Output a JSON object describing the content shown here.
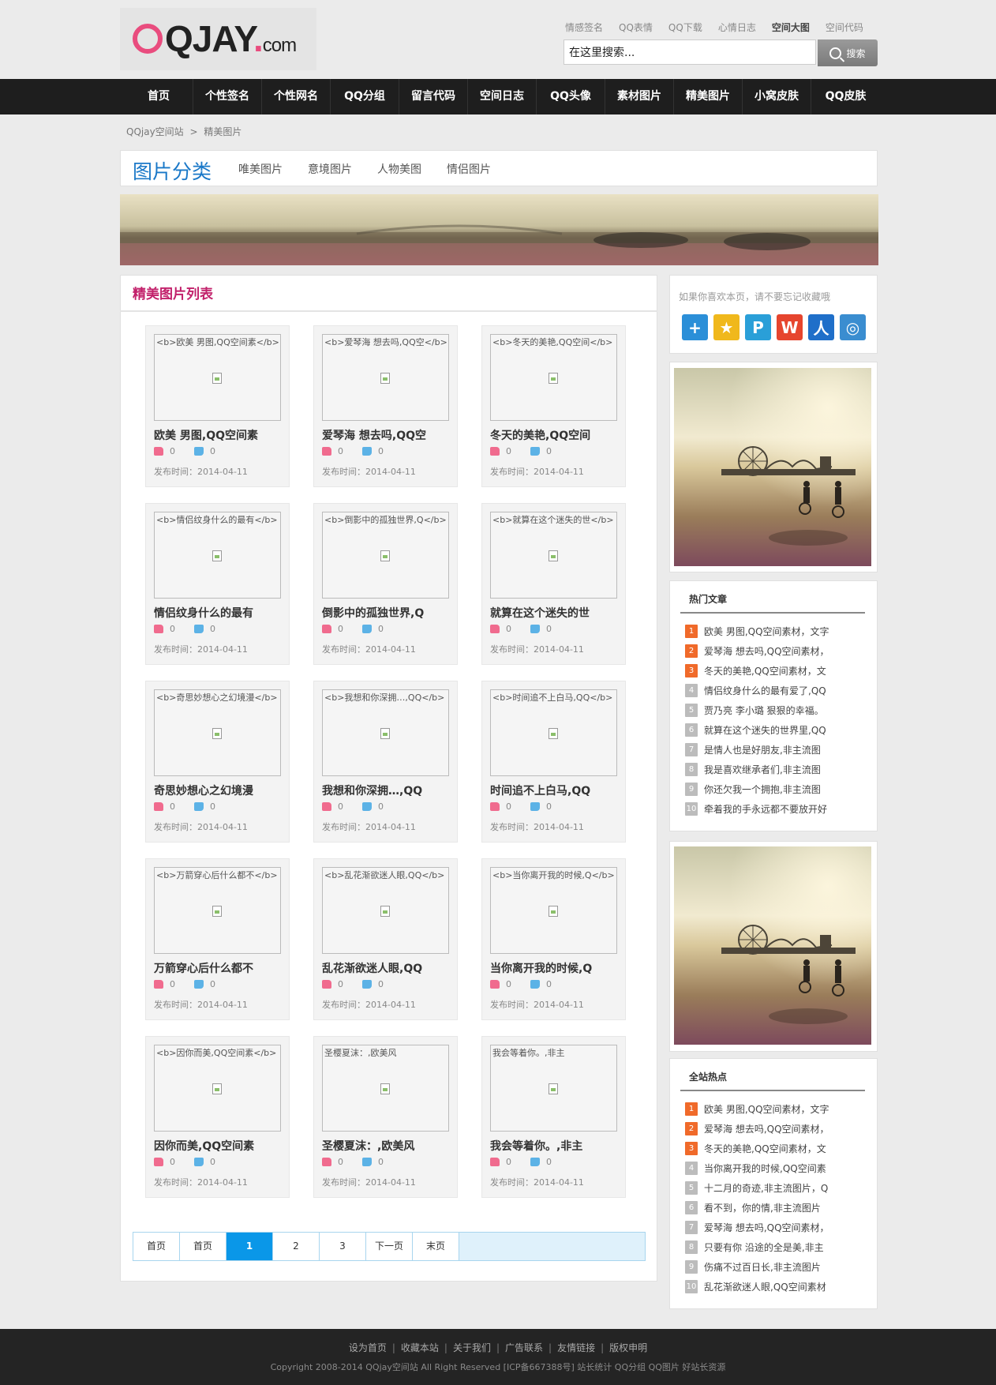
{
  "header": {
    "logo": {
      "main": "QJAY",
      "dot": ".",
      "suffix": "com"
    },
    "top_links": [
      {
        "label": "情感签名",
        "bold": false
      },
      {
        "label": "QQ表情",
        "bold": false
      },
      {
        "label": "QQ下载",
        "bold": false
      },
      {
        "label": "心情日志",
        "bold": false
      },
      {
        "label": "空间大图",
        "bold": true
      },
      {
        "label": "空间代码",
        "bold": false
      }
    ],
    "search": {
      "value": "在这里搜索...",
      "button_label": "搜索"
    }
  },
  "nav": {
    "items": [
      "首页",
      "个性签名",
      "个性网名",
      "QQ分组",
      "留言代码",
      "空间日志",
      "QQ头像",
      "素材图片",
      "精美图片",
      "小窝皮肤",
      "QQ皮肤"
    ]
  },
  "breadcrumb": {
    "home": "QQjay空间站",
    "separator": ">",
    "current": "精美图片"
  },
  "category": {
    "title": "图片分类",
    "links": [
      "唯美图片",
      "意境图片",
      "人物美图",
      "情侣图片"
    ]
  },
  "main": {
    "list_title": "精美图片列表",
    "date_prefix": "发布时间：",
    "cards": [
      {
        "alt": "<b>欧美 男图,QQ空间素</b>",
        "title": "欧美 男图,QQ空间素",
        "up": "0",
        "down": "0",
        "date": "2014-04-11"
      },
      {
        "alt": "<b>爱琴海 想去吗,QQ空</b>",
        "title": "爱琴海 想去吗,QQ空",
        "up": "0",
        "down": "0",
        "date": "2014-04-11"
      },
      {
        "alt": "<b>冬天的美艳,QQ空间</b>",
        "title": "冬天的美艳,QQ空间",
        "up": "0",
        "down": "0",
        "date": "2014-04-11"
      },
      {
        "alt": "<b>情侣纹身什么的最有</b>",
        "title": "情侣纹身什么的最有",
        "up": "0",
        "down": "0",
        "date": "2014-04-11"
      },
      {
        "alt": "<b>倒影中的孤独世界,Q</b>",
        "title": "倒影中的孤独世界,Q",
        "up": "0",
        "down": "0",
        "date": "2014-04-11"
      },
      {
        "alt": "<b>就算在这个迷失的世</b>",
        "title": "就算在这个迷失的世",
        "up": "0",
        "down": "0",
        "date": "2014-04-11"
      },
      {
        "alt": "<b>奇思妙想心之幻境漫</b>",
        "title": "奇思妙想心之幻境漫",
        "up": "0",
        "down": "0",
        "date": "2014-04-11"
      },
      {
        "alt": "<b>我想和你深拥…,QQ</b>",
        "title": "我想和你深拥…,QQ",
        "up": "0",
        "down": "0",
        "date": "2014-04-11"
      },
      {
        "alt": "<b>时间追不上白马,QQ</b>",
        "title": "时间追不上白马,QQ",
        "up": "0",
        "down": "0",
        "date": "2014-04-11"
      },
      {
        "alt": "<b>万箭穿心后什么都不</b>",
        "title": "万箭穿心后什么都不",
        "up": "0",
        "down": "0",
        "date": "2014-04-11"
      },
      {
        "alt": "<b>乱花渐欲迷人眼,QQ</b>",
        "title": "乱花渐欲迷人眼,QQ",
        "up": "0",
        "down": "0",
        "date": "2014-04-11"
      },
      {
        "alt": "<b>当你离开我的时候,Q</b>",
        "title": "当你离开我的时候,Q",
        "up": "0",
        "down": "0",
        "date": "2014-04-11"
      },
      {
        "alt": "<b>因你而美,QQ空间素</b>",
        "title": "因你而美,QQ空间素",
        "up": "0",
        "down": "0",
        "date": "2014-04-11"
      },
      {
        "alt": "圣樱夏沫：,欧美风",
        "title": "圣樱夏沫：,欧美风",
        "up": "0",
        "down": "0",
        "date": "2014-04-11"
      },
      {
        "alt": "我会等着你。,非主",
        "title": "我会等着你。,非主",
        "up": "0",
        "down": "0",
        "date": "2014-04-11"
      }
    ]
  },
  "pagination": {
    "items": [
      {
        "label": "首页",
        "current": false
      },
      {
        "label": "首页",
        "current": false
      },
      {
        "label": "1",
        "current": true
      },
      {
        "label": "2",
        "current": false
      },
      {
        "label": "3",
        "current": false
      },
      {
        "label": "下一页",
        "current": false
      },
      {
        "label": "末页",
        "current": false
      }
    ]
  },
  "sidebar": {
    "favorite_text": "如果你喜欢本页，请不要忘记收藏哦",
    "share_icons": [
      {
        "icon": "add-plus-icon",
        "glyph": "+",
        "color": "#2b8fd8"
      },
      {
        "icon": "qzone-star-icon",
        "glyph": "★",
        "color": "#f0b81c"
      },
      {
        "icon": "pengyou-icon",
        "glyph": "P",
        "color": "#2a9fd8"
      },
      {
        "icon": "weibo-icon",
        "glyph": "W",
        "color": "#e6452e"
      },
      {
        "icon": "renren-icon",
        "glyph": "人",
        "color": "#1f6fc9"
      },
      {
        "icon": "tencent-weibo-icon",
        "glyph": "◎",
        "color": "#3a8dd0"
      }
    ],
    "hot_articles": {
      "title": "热门文章",
      "items": [
        "欧美 男图,QQ空间素材，文字",
        "爱琴海 想去吗,QQ空间素材，",
        "冬天的美艳,QQ空间素材，文",
        "情侣纹身什么的最有爱了,QQ",
        "贾乃亮 李小璐 狠狠的幸福。",
        "就算在这个迷失的世界里,QQ",
        "是情人也是好朋友,非主流图",
        "我是喜欢继承者们,非主流图",
        "你还欠我一个拥抱,非主流图",
        "牵着我的手永远都不要放开好"
      ]
    },
    "site_hot": {
      "title": "全站热点",
      "items": [
        "欧美 男图,QQ空间素材，文字",
        "爱琴海 想去吗,QQ空间素材，",
        "冬天的美艳,QQ空间素材，文",
        "当你离开我的时候,QQ空间素",
        "十二月的奇迹,非主流图片，Q",
        "看不到，你的情,非主流图片",
        "爱琴海 想去吗,QQ空间素材，",
        "只要有你 沿途的全是美,非主",
        "伤痛不过百日长,非主流图片",
        "乱花渐欲迷人眼,QQ空间素材"
      ]
    }
  },
  "footer": {
    "links": [
      "设为首页",
      "收藏本站",
      "关于我们",
      "广告联系",
      "友情链接",
      "版权申明"
    ],
    "link_separator": "|",
    "copyright": "Copyright 2008-2014 QQjay空间站 All Right Reserved [ICP备667388号] 站长统计 QQ分组 QQ图片 好站长资源"
  },
  "colors": {
    "brand_pink": "#e94c7e",
    "nav_bg": "#1e1e1e",
    "category_blue": "#1a78c8",
    "list_title": "#c2216b",
    "page_current": "#0a97e8",
    "rank_hot": "#f06a2a",
    "rank_normal": "#bcbcbc"
  }
}
